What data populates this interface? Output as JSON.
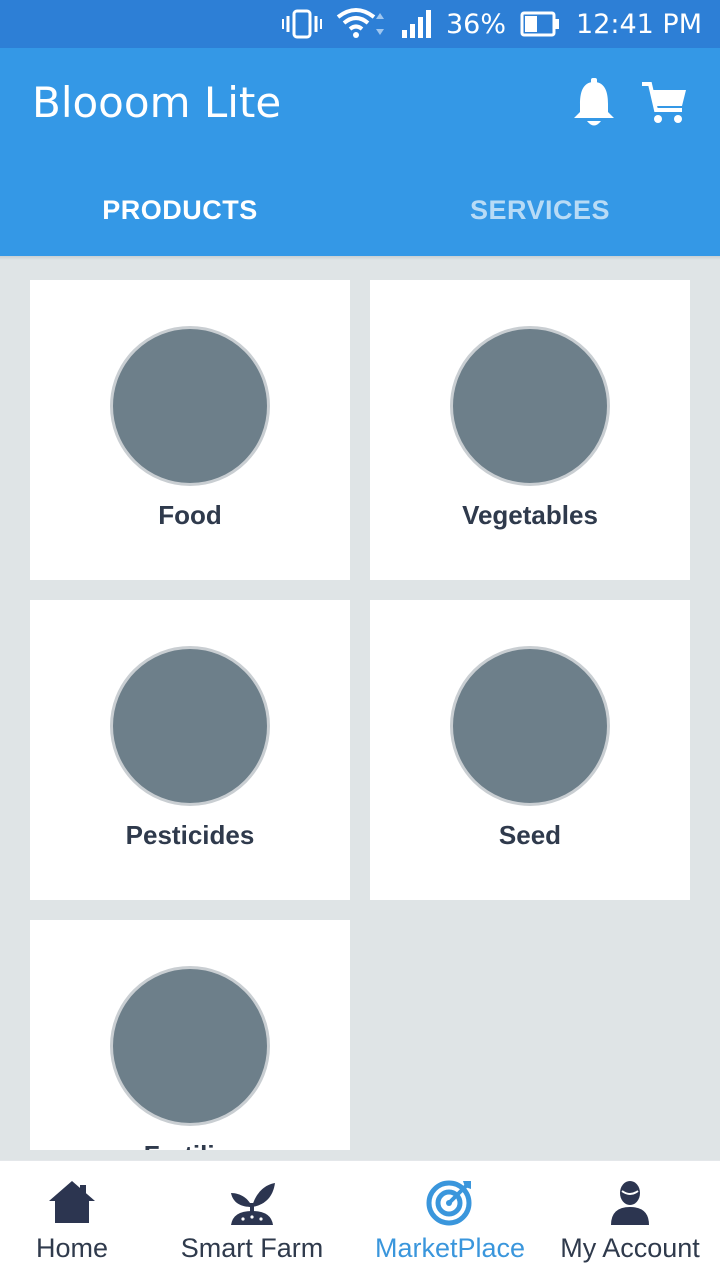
{
  "status_bar": {
    "battery": "36%",
    "time": "12:41 PM",
    "icons": [
      "vibrate-icon",
      "wifi-icon",
      "signal-icon",
      "battery-icon"
    ]
  },
  "app": {
    "title": "Blooom Lite",
    "actions": [
      "bell-icon",
      "cart-icon"
    ]
  },
  "tabs": [
    {
      "label": "PRODUCTS",
      "active": true
    },
    {
      "label": "SERVICES",
      "active": false
    }
  ],
  "categories": [
    {
      "label": "Food"
    },
    {
      "label": "Vegetables"
    },
    {
      "label": "Pesticides"
    },
    {
      "label": "Seed"
    },
    {
      "label": "Fertili..."
    }
  ],
  "bottom_nav": [
    {
      "label": "Home",
      "icon": "home-icon",
      "active": false
    },
    {
      "label": "Smart Farm",
      "icon": "plant-icon",
      "active": false
    },
    {
      "label": "MarketPlace",
      "icon": "target-icon",
      "active": true
    },
    {
      "label": "My Account",
      "icon": "user-icon",
      "active": false
    }
  ],
  "colors": {
    "primary": "#3498e6",
    "status_bar": "#2d7fd6",
    "background": "#dfe4e6",
    "text_dark": "#2f3a4c",
    "active_nav": "#3a96dc"
  }
}
